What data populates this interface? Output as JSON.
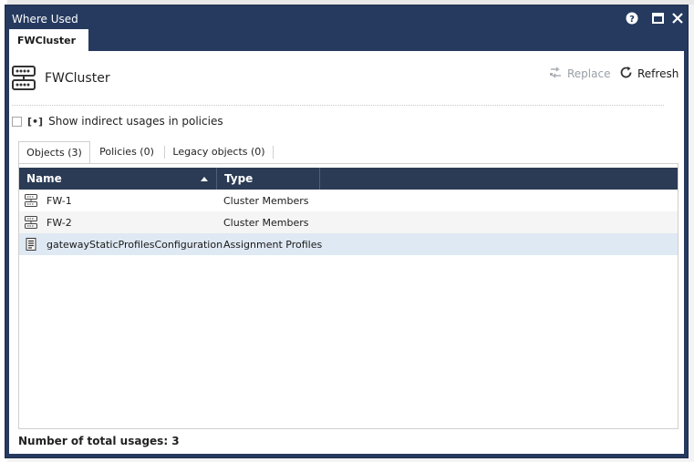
{
  "dialog": {
    "title": "Where Used",
    "tab_label": "FWCluster"
  },
  "header": {
    "object_name": "FWCluster",
    "replace_label": "Replace",
    "refresh_label": "Refresh"
  },
  "options": {
    "show_indirect_label": "Show indirect usages in policies",
    "show_indirect_checked": false
  },
  "tabs": [
    {
      "label": "Objects (3)",
      "active": true
    },
    {
      "label": "Policies (0)",
      "active": false
    },
    {
      "label": "Legacy objects (0)",
      "active": false
    }
  ],
  "table": {
    "columns": [
      "Name",
      "Type"
    ],
    "sorted_column": "Name",
    "rows": [
      {
        "icon": "cluster-member-icon",
        "name": "FW-1",
        "type": "Cluster Members"
      },
      {
        "icon": "cluster-member-icon",
        "name": "FW-2",
        "type": "Cluster Members"
      },
      {
        "icon": "profile-document-icon",
        "name": "gatewayStaticProfilesConfiguration",
        "type": "Assignment Profiles",
        "selected": true
      }
    ]
  },
  "footer": {
    "total_usages": "Number of total usages: 3"
  },
  "colors": {
    "title_bar": "#253a5e",
    "grid_header": "#2b3b55",
    "selected_row": "#dfe9f3"
  }
}
